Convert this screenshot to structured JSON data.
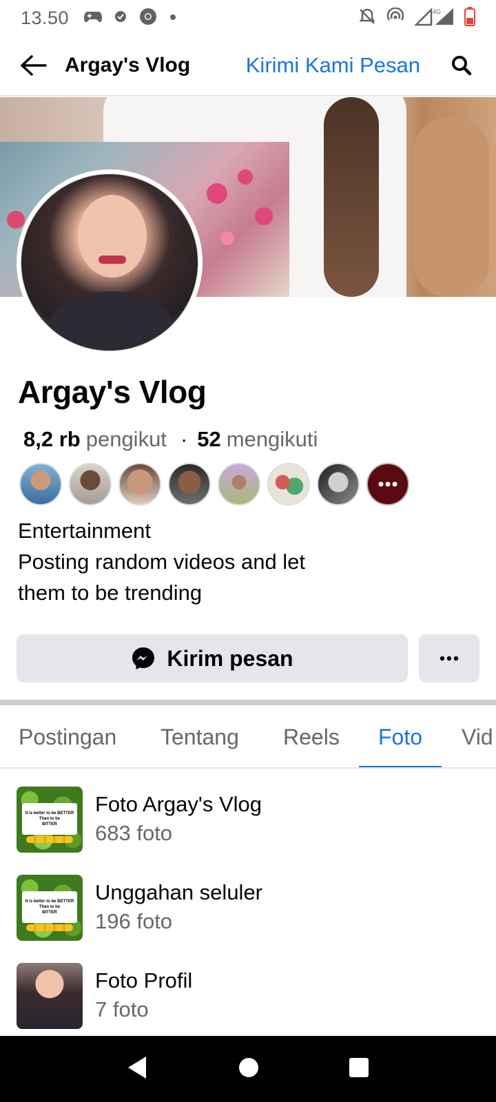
{
  "status_bar": {
    "time": "13.50",
    "network": "4G"
  },
  "header": {
    "title": "Argay's Vlog",
    "message_link": "Kirimi Kami Pesan"
  },
  "profile": {
    "name": "Argay's Vlog",
    "followers_count": "8,2 rb",
    "followers_label": "pengikut",
    "following_count": "52",
    "following_label": "mengikuti",
    "bio_category": "Entertainment",
    "bio_line2": "Posting random videos and let",
    "bio_line3": "them to be trending"
  },
  "actions": {
    "message_button": "Kirim pesan"
  },
  "tabs": [
    {
      "label": "Postingan",
      "active": false
    },
    {
      "label": "Tentang",
      "active": false
    },
    {
      "label": "Reels",
      "active": false
    },
    {
      "label": "Foto",
      "active": true
    },
    {
      "label": "Vid",
      "active": false
    }
  ],
  "albums": [
    {
      "title": "Foto Argay's Vlog",
      "count": "683 foto",
      "thumb_text": [
        "It is better to be BETTER",
        "Than to be",
        "BITTER"
      ]
    },
    {
      "title": "Unggahan seluler",
      "count": "196 foto",
      "thumb_text": [
        "It is better to be BETTER",
        "Than to be",
        "BITTER"
      ]
    },
    {
      "title": "Foto Profil",
      "count": "7 foto"
    }
  ],
  "colors": {
    "accent": "#1b74e4",
    "button_bg": "#e4e6eb",
    "secondary_text": "#65676b"
  }
}
